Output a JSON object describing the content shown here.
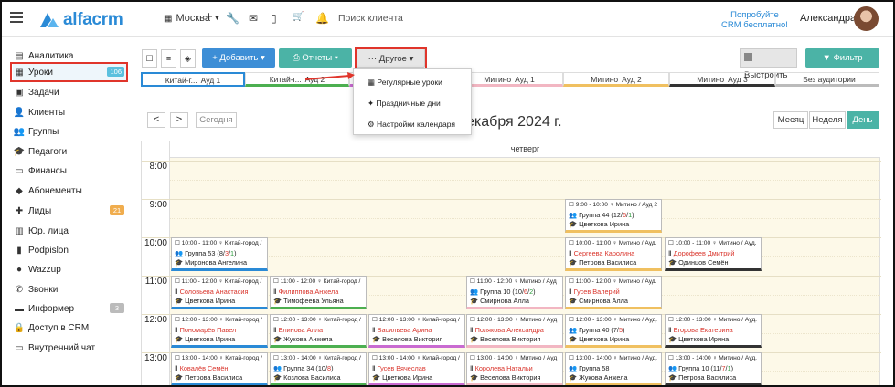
{
  "header": {
    "logo_text": "alfacrm",
    "branch": "Москва",
    "search_placeholder": "Поиск клиента",
    "promo_line1": "Попробуйте",
    "promo_line2": "CRM бесплатно!",
    "user_name": "Александра"
  },
  "sidebar": {
    "items": [
      {
        "label": "Аналитика",
        "icon": "chart-icon"
      },
      {
        "label": "Уроки",
        "icon": "calendar-icon",
        "badge": "106",
        "badge_color": "#5bc0de"
      },
      {
        "label": "Задачи",
        "icon": "tasks-icon"
      },
      {
        "label": "Клиенты",
        "icon": "user-icon"
      },
      {
        "label": "Группы",
        "icon": "group-icon"
      },
      {
        "label": "Педагоги",
        "icon": "teacher-icon"
      },
      {
        "label": "Финансы",
        "icon": "money-icon"
      },
      {
        "label": "Абонементы",
        "icon": "ticket-icon"
      },
      {
        "label": "Лиды",
        "icon": "lead-icon",
        "badge": "21",
        "badge_color": "#f0ad4e"
      },
      {
        "label": "Юр. лица",
        "icon": "building-icon"
      },
      {
        "label": "Podpislon",
        "icon": "document-icon"
      },
      {
        "label": "Wazzup",
        "icon": "whatsapp-icon"
      },
      {
        "label": "Звонки",
        "icon": "phone-icon"
      },
      {
        "label": "Информер",
        "icon": "informer-icon",
        "badge": "3",
        "badge_color": "#bbbbbb"
      },
      {
        "label": "Доступ в CRM",
        "icon": "lock-icon"
      },
      {
        "label": "Внутренний чат",
        "icon": "chat-icon"
      }
    ]
  },
  "toolbar": {
    "add_label": "+ Добавить",
    "reports_label": "Отчеты",
    "other_label": "··· Другое",
    "fix_label": "Выстроить",
    "filter_label": "Фильтр",
    "accent_blue": "#3d8ed6",
    "accent_teal": "#4bb3a6",
    "accent_gray": "#e6e6e6"
  },
  "dropdown": {
    "items": [
      "Регулярные уроки",
      "Праздничные дни",
      "Настройки календаря"
    ]
  },
  "auditoria": [
    {
      "branch": "Китай-г...",
      "room": "Ауд 1",
      "color": "#2a8ad6"
    },
    {
      "branch": "Китай-г...",
      "room": "Ауд 2",
      "color": "#4caf50"
    },
    {
      "branch": "",
      "room": "",
      "color": "#c96bd1"
    },
    {
      "branch": "Митино",
      "room": "Ауд 1",
      "color": "#f2b6c2"
    },
    {
      "branch": "Митино",
      "room": "Ауд 2",
      "color": "#f0c060"
    },
    {
      "branch": "Митино",
      "room": "Ауд 3",
      "color": "#333333"
    },
    {
      "branch": "",
      "room": "Без аудитории",
      "color": "#bbbbbb"
    }
  ],
  "nav": {
    "prev": "<",
    "next": ">",
    "today": "Сегодня",
    "date_title": "екабря 2024 г.",
    "views": [
      "Месяц",
      "Неделя",
      "День"
    ],
    "active_view": "День"
  },
  "calendar": {
    "day_header": "четверг",
    "hours": [
      "8:00",
      "9:00",
      "10:00",
      "11:00",
      "12:00",
      "13:00"
    ],
    "lessons": [
      {
        "time": "9:00 - 10:00 ♀ Митино / Ауд 2",
        "group": "Группа 44 (",
        "c1": "12",
        "c2": "6",
        "c3": "1",
        "who": "Цветкова Ирина",
        "color": "#f0c060"
      },
      {
        "time": "10:00 - 11:00 ♀ Китай-город /",
        "group": "Группа 53 (",
        "c1": "8",
        "c2": "3",
        "c3": "1",
        "who": "Миронова Ангелина",
        "color": "#2a8ad6"
      },
      {
        "time": "10:00 - 11:00 ♀ Митино / Ауд.",
        "student": "Сергеева Каролина",
        "who": "Петрова Василиса",
        "color": "#f0c060"
      },
      {
        "time": "10:00 - 11:00 ♀ Митино / Ауд.",
        "student": "Дорофеев Дмитрий",
        "who": "Одинцов Семён",
        "color": "#333333"
      },
      {
        "time": "11:00 - 12:00 ♀ Китай-город /",
        "student": "Соловьева Анастасия",
        "who": "Цветкова Ирина",
        "color": "#2a8ad6"
      },
      {
        "time": "11:00 - 12:00 ♀ Китай-город /",
        "student": "Филиппова Анжела",
        "who": "Тимофеева Ульяна",
        "color": "#4caf50"
      },
      {
        "time": "11:00 - 12:00 ♀ Митино / Ауд",
        "group": "Группа 10 (",
        "c1": "10",
        "c2": "6",
        "c3": "2",
        "who": "Смирнова Алла",
        "color": "#f2b6c2"
      },
      {
        "time": "11:00 - 12:00 ♀ Митино / Ауд.",
        "student": "Гусев Валерий",
        "who": "Смирнова Алла",
        "color": "#f0c060"
      },
      {
        "time": "12:00 - 13:00 ♀ Китай-город /",
        "student": "Пономарёв Павел",
        "who": "Цветкова Ирина",
        "color": "#2a8ad6"
      },
      {
        "time": "12:00 - 13:00 ♀ Китай-город /",
        "student": "Блинова Алла",
        "who": "Жукова Анжела",
        "color": "#4caf50"
      },
      {
        "time": "12:00 - 13:00 ♀ Китай-город /",
        "student": "Васильева Арина",
        "who": "Веселова Виктория",
        "color": "#c96bd1"
      },
      {
        "time": "12:00 - 13:00 ♀ Митино / Ауд",
        "student": "Полякова Александра",
        "who": "Веселова Виктория",
        "color": "#f2b6c2"
      },
      {
        "time": "12:00 - 13:00 ♀ Митино / Ауд.",
        "group": "Группа 40 (",
        "c1": "7",
        "c2": "5",
        "who": "Цветкова Ирина",
        "color": "#f0c060"
      },
      {
        "time": "12:00 - 13:00 ♀ Митино / Ауд.",
        "student": "Егорова Екатерина",
        "who": "Цветкова Ирина",
        "color": "#333333"
      },
      {
        "time": "13:00 - 14:00 ♀ Китай-город /",
        "student": "Ковалёв Семён",
        "who": "Петрова Василиса",
        "color": "#2a8ad6"
      },
      {
        "time": "13:00 - 14:00 ♀ Китай-город /",
        "group": "Группа 34 (",
        "c1": "10",
        "c2": "8",
        "who": "Козлова Василиса",
        "color": "#4caf50"
      },
      {
        "time": "13:00 - 14:00 ♀ Китай-город /",
        "student": "Гусев Вячеслав",
        "who": "Цветкова Ирина",
        "color": "#c96bd1"
      },
      {
        "time": "13:00 - 14:00 ♀ Митино / Ауд",
        "student": "Королева Натальи",
        "who": "Веселова Виктория",
        "color": "#f2b6c2"
      },
      {
        "time": "13:00 - 14:00 ♀ Митино / Ауд.",
        "group": "Группа 58",
        "who": "Жукова Анжела",
        "color": "#f0c060"
      },
      {
        "time": "13:00 - 14:00 ♀ Митино / Ауд.",
        "group": "Группа 10 (",
        "c1": "11",
        "c2": "7",
        "c3": "1",
        "who": "Петрова Василиса",
        "color": "#333333"
      }
    ]
  }
}
